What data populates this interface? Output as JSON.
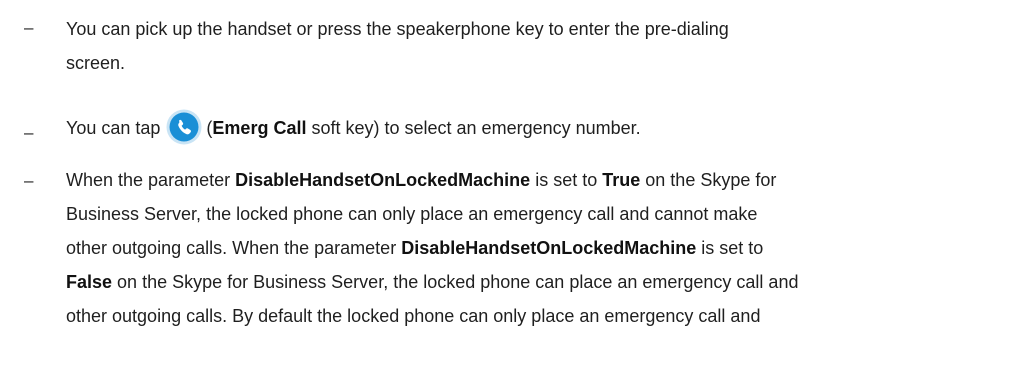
{
  "bullets": [
    {
      "lines": [
        "You can pick up the handset or press the speakerphone key to enter the pre-dialing",
        "screen."
      ]
    },
    {
      "prefix": "You can tap",
      "icon": "phone-call-icon",
      "paren_open": "(",
      "softkey_label": "Emerg Call",
      "softkey_suffix": "soft key) to select an emergency number."
    },
    {
      "p1": "When the parameter",
      "param1": "DisableHandsetOnLockedMachine",
      "p2": "is set to",
      "val_true": "True",
      "p3": "on the Skype for",
      "line2": "Business Server, the locked phone can only place an emergency call and cannot make",
      "p4": "other outgoing calls. When the parameter",
      "param2": "DisableHandsetOnLockedMachine",
      "p5": "is set to",
      "val_false": "False",
      "p6": "on the Skype for Business Server, the locked phone can place an emergency call and",
      "line5": "other outgoing calls. By default the locked phone can only place an emergency call and"
    }
  ],
  "dash_char": "–",
  "colors": {
    "icon_bg": "#1a8fd6",
    "icon_ring": "#c9e4f5",
    "text": "#1f1f1f"
  }
}
